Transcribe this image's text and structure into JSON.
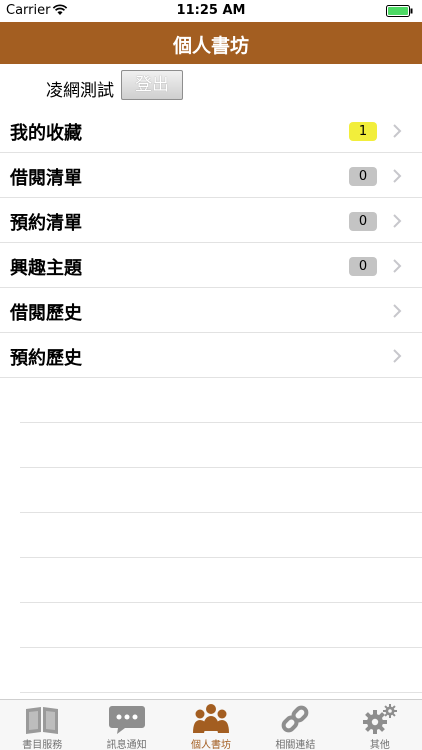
{
  "status_bar": {
    "carrier": "Carrier",
    "time": "11:25 AM"
  },
  "nav": {
    "title": "個人書坊"
  },
  "user": {
    "name": "凌網測試",
    "logout_label": "登出"
  },
  "list": {
    "items": [
      {
        "label": "我的收藏",
        "badge": "1",
        "badge_color": "#f2ee3b"
      },
      {
        "label": "借閱清單",
        "badge": "0",
        "badge_color": "#c4c4c4"
      },
      {
        "label": "預約清單",
        "badge": "0",
        "badge_color": "#c4c4c4"
      },
      {
        "label": "興趣主題",
        "badge": "0",
        "badge_color": "#c4c4c4"
      },
      {
        "label": "借閱歷史"
      },
      {
        "label": "預約歷史"
      }
    ]
  },
  "tabs": [
    {
      "label": "書目服務",
      "icon": "book-icon"
    },
    {
      "label": "訊息通知",
      "icon": "chat-bubble-icon"
    },
    {
      "label": "個人書坊",
      "icon": "people-icon",
      "active": true
    },
    {
      "label": "相關連結",
      "icon": "link-icon"
    },
    {
      "label": "其他",
      "icon": "gear-icon"
    }
  ],
  "colors": {
    "brand": "#a35e21",
    "active_tab": "#a35e21",
    "inactive_tab": "#707070"
  }
}
